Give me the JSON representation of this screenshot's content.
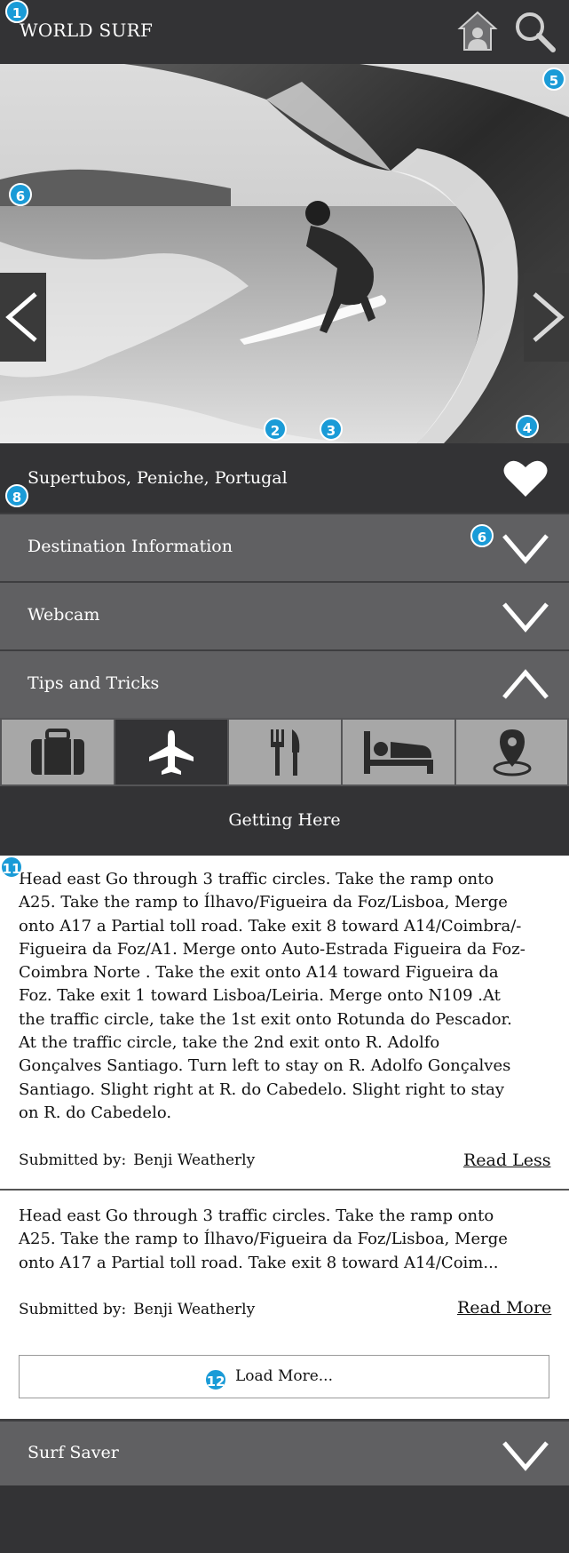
{
  "header": {
    "title": "WORLD SURF"
  },
  "annotations": [
    "1",
    "2",
    "3",
    "4",
    "5",
    "6",
    "6",
    "8",
    "11",
    "12"
  ],
  "location": {
    "name": "Supertubos, Peniche, Portugal"
  },
  "accordion": [
    {
      "label": "Destination Information"
    },
    {
      "label": "Webcam"
    },
    {
      "label": "Tips and Tricks"
    }
  ],
  "tabs": [
    {
      "icon": "briefcase-icon",
      "active": false
    },
    {
      "icon": "airplane-icon",
      "active": true
    },
    {
      "icon": "fork-knife-icon",
      "active": false
    },
    {
      "icon": "bed-icon",
      "active": false
    },
    {
      "icon": "map-pin-icon",
      "active": false
    }
  ],
  "section": {
    "title": "Getting Here"
  },
  "tips": [
    {
      "lines": [
        "Head east Go through 3 traffic circles. Take the ramp onto",
        "A25. Take the ramp to Ílhavo/Figueira da Foz/Lisboa, Merge",
        "onto A17 a Partial toll road. Take exit 8 toward A14/Coimbra/-",
        "Figueira da Foz/A1. Merge onto Auto-Estrada Figueira da Foz-",
        "Coimbra Norte . Take the exit onto A14 toward Figueira da",
        "Foz. Take exit 1 toward Lisboa/Leiria. Merge onto N109 .At",
        "the traffic circle, take the 1st exit onto Rotunda do Pescador.",
        "At the traffic circle, take the 2nd exit onto R. Adolfo",
        "Gonçalves Santiago. Turn left to stay on R. Adolfo Gonçalves",
        "Santiago. Slight right at R. do Cabedelo. Slight right to stay",
        "on R. do Cabedelo."
      ],
      "submitted_label": "Submitted by:",
      "author": "Benji Weatherly",
      "toggle": "Read Less"
    },
    {
      "lines": [
        "Head east Go through 3 traffic circles. Take the ramp onto",
        "A25. Take the ramp to Ílhavo/Figueira da Foz/Lisboa, Merge",
        "onto A17 a Partial toll road. Take exit 8 toward A14/Coim..."
      ],
      "submitted_label": "Submitted by:",
      "author": "Benji Weatherly",
      "toggle": "Read More"
    }
  ],
  "load_more": {
    "label": "Load More..."
  },
  "surf_saver": {
    "label": "Surf Saver"
  },
  "colors": {
    "header": "#333335",
    "accordion": "#606062",
    "tab_inactive": "#a7a7a7",
    "badge": "#1a9bd7"
  }
}
